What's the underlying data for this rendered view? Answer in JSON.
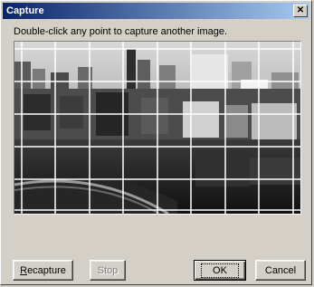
{
  "window": {
    "title": "Capture",
    "close_glyph": "✕"
  },
  "instructions": "Double-click any point to capture another image.",
  "image": {
    "description_icon": "captured-city-image",
    "grid_columns": 8,
    "grid_rows": 5
  },
  "buttons": {
    "recapture_accel": "R",
    "recapture_rest": "ecapture",
    "stop": "Stop",
    "ok": "OK",
    "cancel": "Cancel"
  }
}
